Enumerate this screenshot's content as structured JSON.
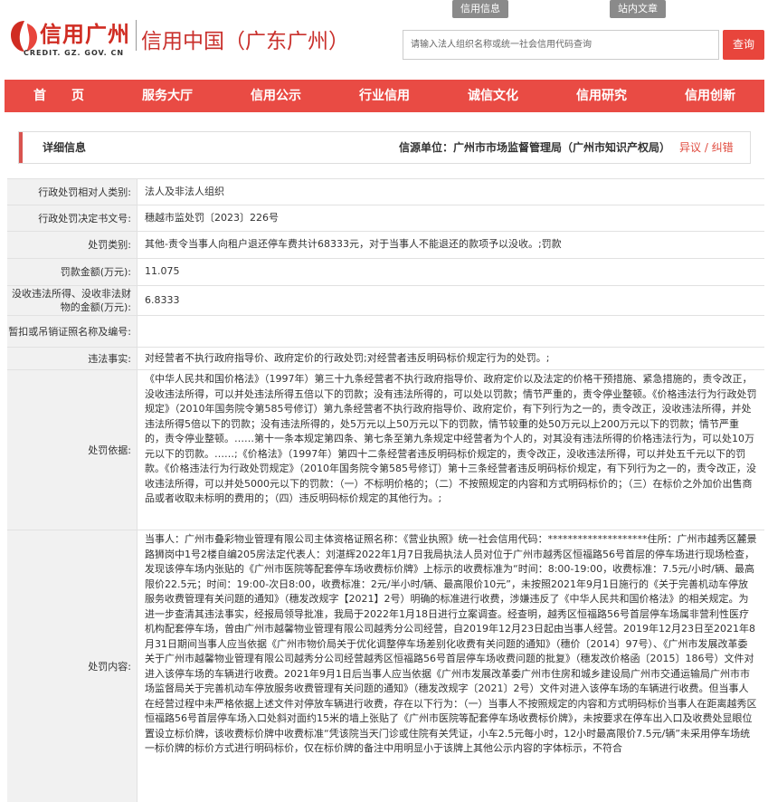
{
  "header": {
    "logo_text": "信用广州",
    "logo_sub": "CREDIT. GZ. GOV. CN",
    "site_title": "信用中国（广东广州）",
    "top_tabs": [
      "信用信息",
      "站内文章"
    ],
    "search_placeholder": "请输入法人组织名称或统一社会信用代码查询",
    "search_button": "查询"
  },
  "nav": [
    "首　　页",
    "服务大厅",
    "信用公示",
    "行业信用",
    "诚信文化",
    "信用研究",
    "信用创新"
  ],
  "detail": {
    "title": "详细信息",
    "source": "信源单位：广州市市场监督管理局（广州市知识产权局）",
    "report": "异议 / 纠错"
  },
  "rows": [
    {
      "label": "行政处罚相对人类别:",
      "value": "法人及非法人组织"
    },
    {
      "label": "行政处罚决定书文号:",
      "value": "穗越市监处罚〔2023〕226号"
    },
    {
      "label": "处罚类别:",
      "value": "其他-责令当事人向租户退还停车费共计68333元，对于当事人不能退还的款项予以没收。;罚款"
    },
    {
      "label": "罚款金额(万元):",
      "value": "11.075"
    },
    {
      "label": "没收违法所得、没收非法财物的金额(万元):",
      "value": "6.8333"
    },
    {
      "label": "暂扣或吊销证照名称及编号:",
      "value": ""
    },
    {
      "label": "违法事实:",
      "value": "对经营者不执行政府指导价、政府定价的行政处罚;对经营者违反明码标价规定行为的处罚。;"
    },
    {
      "label": "处罚依据:",
      "value": "《中华人民共和国价格法》（1997年）第三十九条经营者不执行政府指导价、政府定价以及法定的价格干预措施、紧急措施的，责令改正，没收违法所得，可以并处违法所得五倍以下的罚款；没有违法所得的，可以处以罚款；情节严重的，责令停业整顿。《价格违法行为行政处罚规定》（2010年国务院令第585号修订）第九条经营者不执行政府指导价、政府定价，有下列行为之一的，责令改正，没收违法所得，并处违法所得5倍以下的罚款；没有违法所得的，处5万元以上50万元以下的罚款，情节较重的处50万元以上200万元以下的罚款；情节严重的，责令停业整顿。……第十一条本规定第四条、第七条至第九条规定中经营者为个人的，对其没有违法所得的价格违法行为，可以处10万元以下的罚款。……;《价格法》（1997年）第四十二条经营者违反明码标价规定的，责令改正，没收违法所得，可以并处五千元以下的罚款。《价格违法行为行政处罚规定》（2010年国务院令第585号修订）第十三条经营者违反明码标价规定，有下列行为之一的，责令改正，没收违法所得，可以并处5000元以下的罚款：（一）不标明价格的；（二）不按照规定的内容和方式明码标价的；（三）在标价之外加价出售商品或者收取未标明的费用的；（四）违反明码标价规定的其他行为。;"
    },
    {
      "label": "处罚内容:",
      "value": "当事人：广州市叠彩物业管理有限公司主体资格证照名称：《营业执照》统一社会信用代码：********************住所：广州市越秀区麓景路狮岗中1号2楼自编205房法定代表人：刘湛辉2022年1月7日我局执法人员对位于广州市越秀区恒福路56号首层的停车场进行现场检查，发现该停车场内张贴的《广州市医院等配套停车场收费标价牌》上标示的收费标准为“时间：8:00-19:00，收费标准：7.5元/小时/辆、最高限价22.5元；时间：19:00-次日8:00，收费标准：2元/半小时/辆、最高限价10元”，未按照2021年9月1日施行的《关于完善机动车停放服务收费管理有关问题的通知》（穗发改规字【2021】2号）明确的标准进行收费，涉嫌违反了《中华人民共和国价格法》的相关规定。为进一步查清其违法事实，经报局领导批准，我局于2022年1月18日进行立案调查。经查明，越秀区恒福路56号首层停车场属非营利性医疗机构配套停车场，曾由广州市越馨物业管理有限公司越秀分公司经营，自2019年12月23日起由当事人经营。2019年12月23日至2021年8月31日期间当事人应当依据《广州市物价局关于优化调整停车场差别化收费有关问题的通知》（穗价〔2014〕97号）、《广州市发展改革委关于广州市越馨物业管理有限公司越秀分公司经营越秀区恒福路56号首层停车场收费问题的批复》（穗发改价格函〔2015〕186号）文件对进入该停车场的车辆进行收费。2021年9月1日后当事人应当依据《广州市发展改革委广州市住房和城乡建设局广州市交通运输局广州市市场监督局关于完善机动车停放服务收费管理有关问题的通知》（穗发改规字〔2021〕2号）文件对进入该停车场的车辆进行收费。但当事人在经营过程中未严格依据上述文件对停放车辆进行收费，存在以下行为：（一）当事人不按照规定的内容和方式明码标价当事人在距离越秀区恒福路56号首层停车场入口处斜对面约15米的墙上张贴了《广州市医院等配套停车场收费标价牌》，未按要求在停车出入口及收费处显眼位置设立标价牌，该收费标价牌中收费标准“凭该院当天门诊或住院有关凭证，小车2.5元每小时，12小时最高限价7.5元/辆”未采用停车场统一标价牌的标价方式进行明码标价，仅在标价牌的备注中用明显小于该牌上其他公示内容的字体标示，不符合"
    }
  ],
  "colors": {
    "brand_red": "#e94b44",
    "logo_red": "#d02c22",
    "label_bg": "#f1f1f1"
  }
}
